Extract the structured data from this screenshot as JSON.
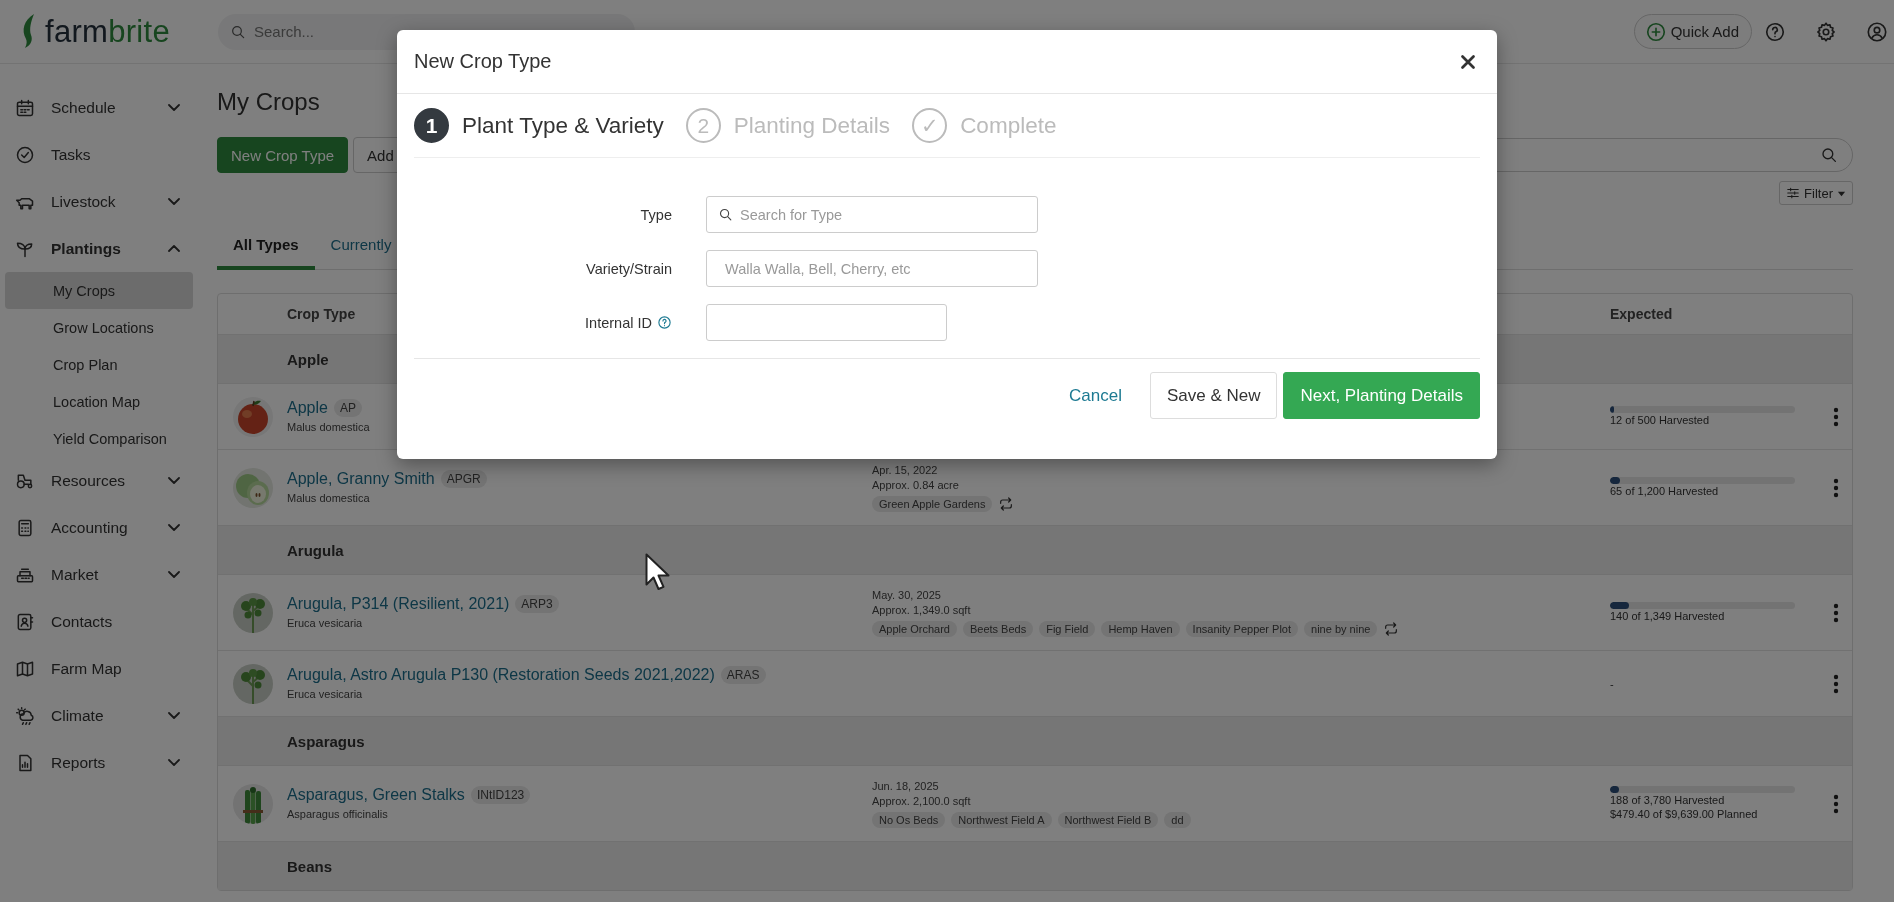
{
  "header": {
    "logo": [
      "farm",
      "brite"
    ],
    "search": {
      "placeholder": "Search..."
    },
    "quick_add": "Quick Add"
  },
  "sidebar": {
    "items": [
      {
        "label": "Schedule",
        "expanded": false
      },
      {
        "label": "Tasks"
      },
      {
        "label": "Livestock",
        "expanded": false
      },
      {
        "label": "Plantings",
        "expanded": true,
        "children": [
          {
            "label": "My Crops",
            "selected": true
          },
          {
            "label": "Grow Locations",
            "selected": false
          },
          {
            "label": "Crop Plan",
            "selected": false
          },
          {
            "label": "Location Map",
            "selected": false
          },
          {
            "label": "Yield Comparison",
            "selected": false
          }
        ]
      },
      {
        "label": "Resources",
        "expanded": false
      },
      {
        "label": "Accounting",
        "expanded": false
      },
      {
        "label": "Market",
        "expanded": false
      },
      {
        "label": "Contacts"
      },
      {
        "label": "Farm Map"
      },
      {
        "label": "Climate",
        "expanded": false
      },
      {
        "label": "Reports",
        "expanded": false
      }
    ]
  },
  "page": {
    "title": "My Crops",
    "actions": [
      {
        "label": "New Crop Type",
        "kind": "primary"
      },
      {
        "label": "Add",
        "kind": "default"
      }
    ],
    "filter": "Filter",
    "tabs": [
      {
        "label": "All Types",
        "selected": true
      },
      {
        "label": "Currently",
        "selected": false
      }
    ],
    "table": {
      "columns": [
        "Crop Type",
        "Expected"
      ],
      "groups": [
        {
          "name": "Apple",
          "rows": [
            {
              "name": "Apple",
              "code": "AP",
              "species": "Malus domestica",
              "expected": {
                "level": 0.024,
                "lines": [
                  "12 of 500 Harvested"
                ]
              }
            },
            {
              "name": "Apple, Granny Smith",
              "code": "APGR",
              "species": "Malus domestica",
              "date": "Apr. 15, 2022",
              "area": "Approx. 0.84 acre",
              "locations": [
                "Green Apple Gardens"
              ],
              "recurring": true,
              "expected": {
                "level": 0.054,
                "lines": [
                  "65 of 1,200 Harvested"
                ]
              }
            }
          ]
        },
        {
          "name": "Arugula",
          "rows": [
            {
              "name": "Arugula, P314 (Resilient, 2021)",
              "code": "ARP3",
              "species": "Eruca vesicaria",
              "date": "May. 30, 2025",
              "area": "Approx. 1,349.0 sqft",
              "locations": [
                "Apple Orchard",
                "Beets Beds",
                "Fig Field",
                "Hemp Haven",
                "Insanity Pepper Plot",
                "nine by nine"
              ],
              "recurring": true,
              "expected": {
                "level": 0.104,
                "lines": [
                  "140 of 1,349 Harvested"
                ]
              }
            },
            {
              "name": "Arugula, Astro Arugula P130 (Restoration Seeds 2021,2022)",
              "code": "ARAS",
              "species": "Eruca vesicaria",
              "expected": {
                "lines": [
                  "-"
                ]
              }
            }
          ]
        },
        {
          "name": "Asparagus",
          "rows": [
            {
              "name": "Asparagus, Green Stalks",
              "code": "INtID123",
              "species": "Asparagus officinalis",
              "date": "Jun. 18, 2025",
              "area": "Approx. 2,100.0 sqft",
              "locations": [
                "No Os Beds",
                "Northwest Field A",
                "Northwest Field B",
                "dd"
              ],
              "recurring": false,
              "expected": {
                "level": 0.05,
                "lines": [
                  "188 of 3,780 Harvested",
                  "$479.40 of $9,639.00 Planned"
                ]
              }
            }
          ]
        },
        {
          "name": "Beans"
        }
      ]
    }
  },
  "modal": {
    "title": "New Crop Type",
    "steps": [
      {
        "number": "1",
        "label": "Plant Type & Variety",
        "current": true
      },
      {
        "number": "2",
        "label": "Planting Details",
        "current": false
      },
      {
        "number": "✓",
        "label": "Complete",
        "current": false
      }
    ],
    "fields": [
      {
        "label": "Type",
        "kind": "search",
        "placeholder": "Search for Type"
      },
      {
        "label": "Variety/Strain",
        "kind": "text",
        "placeholder": "Walla Walla, Bell, Cherry, etc"
      },
      {
        "label": "Internal ID",
        "kind": "short",
        "help": true
      }
    ],
    "buttons": [
      {
        "label": "Cancel",
        "kind": "link"
      },
      {
        "label": "Save & New",
        "kind": "default"
      },
      {
        "label": "Next, Planting Details",
        "kind": "primary"
      }
    ]
  }
}
